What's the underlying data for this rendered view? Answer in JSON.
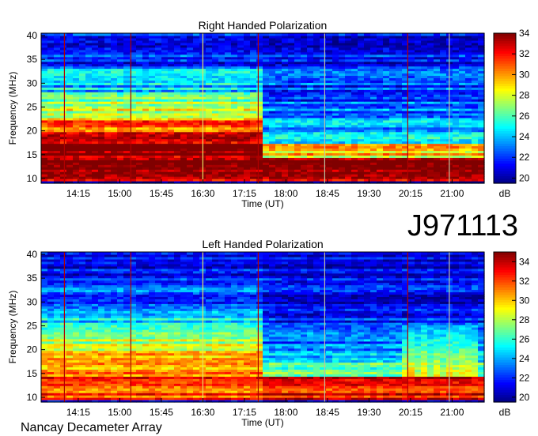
{
  "page": {
    "observation_id": "J971113",
    "instrument": "Nancay Decameter Array"
  },
  "chart_data": [
    {
      "type": "heatmap",
      "title": "Right Handed Polarization",
      "xlabel": "Time (UT)",
      "ylabel": "Frequency (MHz)",
      "x_ticks": [
        "14:15",
        "15:00",
        "15:45",
        "16:30",
        "17:15",
        "18:00",
        "18:45",
        "19:30",
        "20:15",
        "21:00"
      ],
      "y_ticks": [
        10,
        15,
        20,
        25,
        30,
        35,
        40
      ],
      "ylim": [
        9,
        40.5
      ],
      "xlim_hours": [
        13.58,
        21.58
      ],
      "colorbar": {
        "label": "dB",
        "ticks": [
          20,
          22,
          24,
          26,
          28,
          30,
          32,
          34
        ],
        "range": [
          19.5,
          34
        ]
      },
      "bands": [
        {
          "from": 9.5,
          "to": 12.5,
          "value_early": 33,
          "value_late": 33
        },
        {
          "from": 12.5,
          "to": 14.5,
          "value_early": 34,
          "value_late": 34
        },
        {
          "from": 14.5,
          "to": 17.5,
          "value_early": 34,
          "value_late": 29
        },
        {
          "from": 17.5,
          "to": 20,
          "value_early": 33,
          "value_late": 25
        },
        {
          "from": 20,
          "to": 22.5,
          "value_early": 31,
          "value_late": 24
        },
        {
          "from": 22.5,
          "to": 25,
          "value_early": 28,
          "value_late": 23
        },
        {
          "from": 25,
          "to": 28,
          "value_early": 27,
          "value_late": 22.5
        },
        {
          "from": 28,
          "to": 33,
          "value_early": 24,
          "value_late": 22
        },
        {
          "from": 33,
          "to": 40.5,
          "value_early": 21.5,
          "value_late": 21
        }
      ],
      "vertical_lines": [
        {
          "t": 14.0,
          "color": "#b00000"
        },
        {
          "t": 15.2,
          "color": "#b00000"
        },
        {
          "t": 16.5,
          "color": "#e8e060"
        },
        {
          "t": 17.5,
          "color": "#b00000"
        },
        {
          "t": 18.7,
          "color": "#c0c0a0"
        },
        {
          "t": 20.2,
          "color": "#b00000"
        },
        {
          "t": 20.95,
          "color": "#c0c0a0"
        }
      ]
    },
    {
      "type": "heatmap",
      "title": "Left Handed Polarization",
      "xlabel": "Time (UT)",
      "ylabel": "Frequency (MHz)",
      "x_ticks": [
        "14:15",
        "15:00",
        "15:45",
        "16:30",
        "17:15",
        "18:00",
        "18:45",
        "19:30",
        "20:15",
        "21:00"
      ],
      "y_ticks": [
        10,
        15,
        20,
        25,
        30,
        35,
        40
      ],
      "ylim": [
        9,
        40.5
      ],
      "xlim_hours": [
        13.58,
        21.58
      ],
      "colorbar": {
        "label": "dB",
        "ticks": [
          20,
          22,
          24,
          26,
          28,
          30,
          32,
          34
        ],
        "range": [
          19.5,
          35
        ]
      },
      "bands": [
        {
          "from": 9.5,
          "to": 12.5,
          "value_early": 32,
          "value_late": 33
        },
        {
          "from": 12.5,
          "to": 14.5,
          "value_early": 33,
          "value_late": 34
        },
        {
          "from": 14.5,
          "to": 17.5,
          "value_early": 31,
          "value_late": 27
        },
        {
          "from": 17.5,
          "to": 20,
          "value_early": 30,
          "value_late": 24
        },
        {
          "from": 20,
          "to": 22.5,
          "value_early": 28,
          "value_late": 23
        },
        {
          "from": 22.5,
          "to": 25,
          "value_early": 26,
          "value_late": 22.5
        },
        {
          "from": 25,
          "to": 28,
          "value_early": 25,
          "value_late": 22
        },
        {
          "from": 28,
          "to": 33,
          "value_early": 23,
          "value_late": 21.5
        },
        {
          "from": 33,
          "to": 40.5,
          "value_early": 21.5,
          "value_late": 21
        }
      ],
      "bursts": {
        "t_from": 20.1,
        "t_to": 21.5,
        "f_from": 9.5,
        "f_to": 25,
        "peak": 33
      },
      "vertical_lines": [
        {
          "t": 14.0,
          "color": "#b00000"
        },
        {
          "t": 15.2,
          "color": "#b00000"
        },
        {
          "t": 16.5,
          "color": "#e8e060"
        },
        {
          "t": 17.5,
          "color": "#b00000"
        },
        {
          "t": 18.7,
          "color": "#c0c0a0"
        },
        {
          "t": 20.2,
          "color": "#b00000"
        },
        {
          "t": 20.95,
          "color": "#c0c0a0"
        }
      ]
    }
  ]
}
